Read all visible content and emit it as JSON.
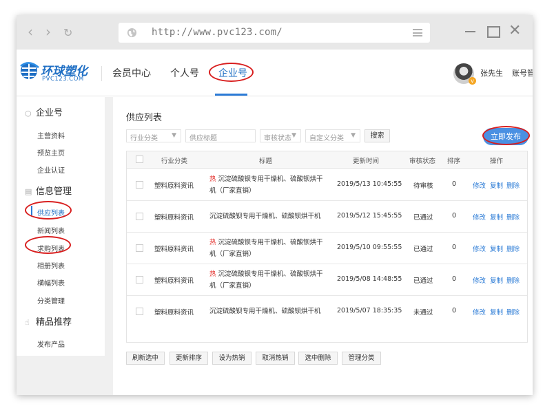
{
  "browser": {
    "url": "http://www.pvc123.com/"
  },
  "header": {
    "logo_cn": "环球塑化",
    "logo_en": "PVC123.COM",
    "nav": [
      "会员中心",
      "个人号",
      "企业号"
    ],
    "username": "张先生",
    "account_link": "账号管"
  },
  "sidebar": {
    "groups": [
      {
        "label": "企业号",
        "icon": "user-icon",
        "items": [
          "主营资料",
          "预览主页",
          "企业认证"
        ]
      },
      {
        "label": "信息管理",
        "icon": "document-icon",
        "items": [
          "供应列表",
          "新闻列表",
          "求购列表",
          "相册列表",
          "横幅列表",
          "分类管理"
        ]
      },
      {
        "label": "精品推荐",
        "icon": "thumbs-up-icon",
        "items": [
          "发布产品"
        ]
      }
    ],
    "active_item": "供应列表"
  },
  "main": {
    "title": "供应列表",
    "filters": {
      "category": "行业分类",
      "title_placeholder": "供应标题",
      "status": "审核状态",
      "custom_category": "自定义分类",
      "search": "搜索"
    },
    "publish_button": "立即发布",
    "table": {
      "headers": [
        "行业分类",
        "标题",
        "更新时间",
        "审核状态",
        "排序",
        "操作"
      ],
      "rows": [
        {
          "category": "塑料原料资讯",
          "hot": "热",
          "title": "沉淀硫酸钡专用干燥机、硫酸钡烘干机（厂家直销）",
          "updated": "2019/5/13 10:45:55",
          "status": "待审核",
          "order": "0",
          "actions": [
            "修改",
            "复制",
            "删除"
          ]
        },
        {
          "category": "塑料原料资讯",
          "hot": "",
          "title": "沉淀硫酸钡专用干燥机、硫酸钡烘干机",
          "updated": "2019/5/12 15:45:55",
          "status": "已通过",
          "order": "0",
          "actions": [
            "修改",
            "复制",
            "删除"
          ]
        },
        {
          "category": "塑料原料资讯",
          "hot": "热",
          "title": "沉淀硫酸钡专用干燥机、硫酸钡烘干机（厂家直销）",
          "updated": "2019/5/10 09:55:55",
          "status": "已通过",
          "order": "0",
          "actions": [
            "修改",
            "复制",
            "删除"
          ]
        },
        {
          "category": "塑料原料资讯",
          "hot": "热",
          "title": "沉淀硫酸钡专用干燥机、硫酸钡烘干机（厂家直销）",
          "updated": "2019/5/08 14:48:55",
          "status": "已通过",
          "order": "0",
          "actions": [
            "修改",
            "复制",
            "删除"
          ]
        },
        {
          "category": "塑料原料资讯",
          "hot": "",
          "title": "沉淀硫酸钡专用干燥机、硫酸钡烘干机",
          "updated": "2019/5/07 18:35:35",
          "status": "未通过",
          "order": "0",
          "actions": [
            "修改",
            "复制",
            "删除"
          ]
        }
      ]
    },
    "bulk_actions": [
      "刷新选中",
      "更新排序",
      "设为热销",
      "取消热销",
      "选中删除",
      "管理分类"
    ]
  },
  "colors": {
    "accent": "#2b7bd6",
    "publish_button": "#4a90e2",
    "hot": "#e53935",
    "annotation_circle": "#d81e1e"
  }
}
